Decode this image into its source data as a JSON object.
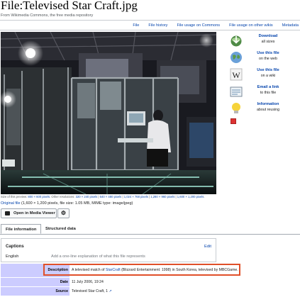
{
  "page": {
    "title": "File:Televised Star Craft.jpg",
    "subtitle": "From Wikimedia Commons, the free media repository"
  },
  "tabs": [
    "File",
    "File history",
    "File usage on Commons",
    "File usage on other wikis",
    "Metadata"
  ],
  "sidebar": [
    {
      "icon": "download-icon",
      "title": "Download",
      "sub": "all sizes"
    },
    {
      "icon": "globe-icon",
      "title": "Use this file",
      "sub": "on the web"
    },
    {
      "icon": "wikipedia-w-icon",
      "title": "Use this file",
      "sub": "on a wiki"
    },
    {
      "icon": "email-icon",
      "title": "Email a link",
      "sub": "to this file"
    },
    {
      "icon": "lightbulb-icon",
      "title": "Information",
      "sub": "about reusing"
    }
  ],
  "sizes": {
    "prefix": "Size of this preview:",
    "preview": "800 × 600 pixels",
    "mid": ". Other resolutions:",
    "other": [
      "320 × 240 pixels",
      "640 × 480 pixels",
      "1,024 × 768 pixels",
      "1,280 × 960 pixels",
      "1,600 × 1,200 pixels"
    ]
  },
  "original": {
    "link": "Original file",
    "details": " (1,600 × 1,200 pixels, file size: 1.05 MB, MIME type: image/jpeg)"
  },
  "buttons": {
    "media_viewer": "Open in Media Viewer"
  },
  "file_tabs": [
    "File information",
    "Structured data"
  ],
  "captions": {
    "title": "Captions",
    "edit": "Edit",
    "lang": "English",
    "placeholder": "Add a one-line explanation of what this file represents"
  },
  "info": {
    "description_label": "Description",
    "description_pre": "A televised match of ",
    "description_link": "StarCraft",
    "description_post": " (Blizzard Entertainment: 1998) in South Korea, televised by MBCGame.",
    "date_label": "Date",
    "date": "11 July 2006, 19:24",
    "source_label": "Source",
    "source": "Televised Star Craft, 1"
  },
  "colors": {
    "link": "#0645ad",
    "label_bg": "#ccccff",
    "highlight": "#e0502a"
  }
}
